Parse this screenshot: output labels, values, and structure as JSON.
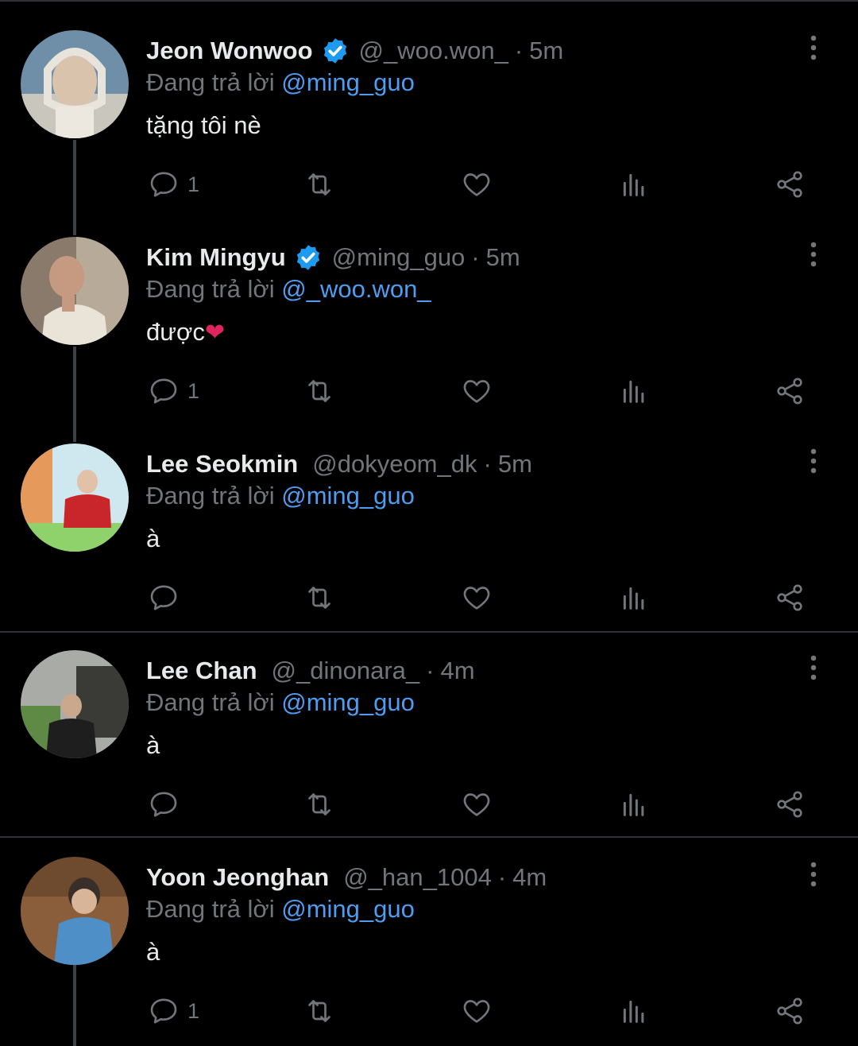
{
  "reply_prefix": "Đang trả lời",
  "tweets": [
    {
      "name": "Jeon Wonwoo",
      "verified": true,
      "handle": "@_woo.won_",
      "time": "5m",
      "reply_to": "@ming_guo",
      "text": "tặng tôi nè",
      "heart": "",
      "reply_count": "1"
    },
    {
      "name": "Kim Mingyu",
      "verified": true,
      "handle": "@ming_guo",
      "time": "5m",
      "reply_to": "@_woo.won_",
      "text": "được",
      "heart": "❤",
      "reply_count": "1"
    },
    {
      "name": "Lee Seokmin",
      "verified": false,
      "handle": "@dokyeom_dk",
      "time": "5m",
      "reply_to": "@ming_guo",
      "text": "à",
      "heart": "",
      "reply_count": ""
    },
    {
      "name": "Lee Chan",
      "verified": false,
      "handle": "@_dinonara_",
      "time": "4m",
      "reply_to": "@ming_guo",
      "text": "à",
      "heart": "",
      "reply_count": ""
    },
    {
      "name": "Yoon Jeonghan",
      "verified": false,
      "handle": "@_han_1004",
      "time": "4m",
      "reply_to": "@ming_guo",
      "text": "à",
      "heart": "",
      "reply_count": "1"
    }
  ],
  "colors": {
    "background": "#000000",
    "text": "#e7e9ea",
    "muted": "#71767b",
    "accent": "#4f9cf0",
    "verified": "#1d9bf0",
    "heart": "#e0245e"
  },
  "icons": {
    "reply": "reply-icon",
    "retweet": "retweet-icon",
    "like": "heart-icon",
    "views": "views-icon",
    "share": "share-icon",
    "more": "more-icon"
  }
}
